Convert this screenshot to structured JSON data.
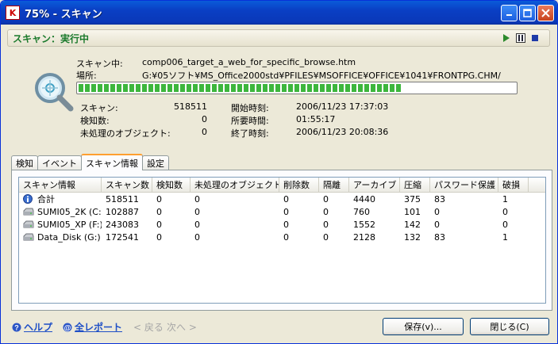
{
  "window": {
    "title": "75% - スキャン"
  },
  "status": {
    "text": "スキャン：実行中"
  },
  "scan": {
    "scanning_label": "スキャン中:",
    "scanning_value": "comp006_target_a_web_for_specific_browse.htm",
    "location_label": "場所:",
    "location_value": "G:¥05ソフト¥MS_Office2000std¥PFILES¥MSOFFICE¥OFFICE¥1041¥FRONTPG.CHM/",
    "progress_percent": 75
  },
  "stats": {
    "scanned_label": "スキャン:",
    "scanned_value": "518511",
    "detected_label": "検知数:",
    "detected_value": "0",
    "unprocessed_label": "未処理のオブジェクト:",
    "unprocessed_value": "0",
    "start_label": "開始時刻:",
    "start_value": "2006/11/23 17:37:03",
    "elapsed_label": "所要時間:",
    "elapsed_value": "01:55:17",
    "end_label": "終了時刻:",
    "end_value": "2006/11/23 20:08:36"
  },
  "tabs": [
    "検知",
    "イベント",
    "スキャン情報",
    "設定"
  ],
  "table": {
    "headers": [
      "スキャン情報",
      "スキャン数",
      "検知数",
      "未処理のオブジェクト",
      "削除数",
      "隔離",
      "アーカイブ",
      "圧縮",
      "パスワード保護",
      "破損"
    ],
    "rows": [
      {
        "icon": "info-icon",
        "cells": [
          "合計",
          "518511",
          "0",
          "0",
          "0",
          "0",
          "4440",
          "375",
          "83",
          "1"
        ]
      },
      {
        "icon": "drive-icon",
        "cells": [
          "SUMI05_2K (C:)",
          "102887",
          "0",
          "0",
          "0",
          "0",
          "760",
          "101",
          "0",
          "0"
        ]
      },
      {
        "icon": "drive-icon",
        "cells": [
          "SUMI05_XP (F:)",
          "243083",
          "0",
          "0",
          "0",
          "0",
          "1552",
          "142",
          "0",
          "0"
        ]
      },
      {
        "icon": "drive-icon",
        "cells": [
          "Data_Disk (G:)",
          "172541",
          "0",
          "0",
          "0",
          "0",
          "2128",
          "132",
          "83",
          "1"
        ]
      }
    ]
  },
  "footer": {
    "help": "ヘルプ",
    "report": "全レポート",
    "back": "< 戻る",
    "next": "次へ >",
    "save": "保存(v)...",
    "close": "閉じる(C)"
  }
}
